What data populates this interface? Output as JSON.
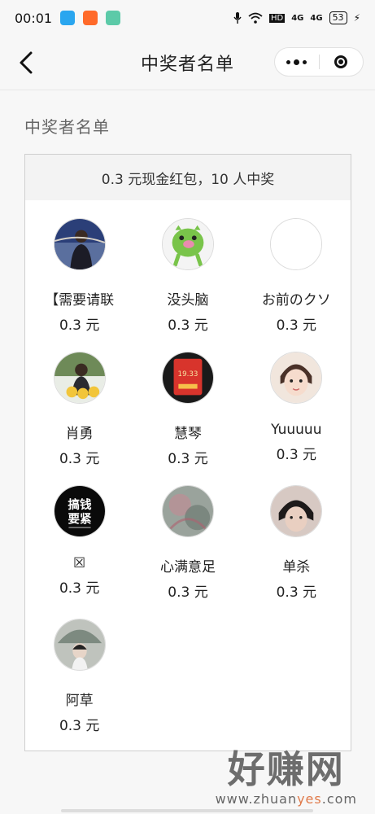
{
  "status_bar": {
    "time": "00:01",
    "signal_1": "4G",
    "signal_2": "4G",
    "hd": "HD",
    "battery": "53"
  },
  "nav": {
    "title": "中奖者名单"
  },
  "section": {
    "title": "中奖者名单"
  },
  "prize": {
    "summary": "0.3 元现金红包，10 人中奖"
  },
  "winners": [
    {
      "name": "【需要请联",
      "amount": "0.3 元",
      "avatar": "photo-man-outdoor"
    },
    {
      "name": "没头脑",
      "amount": "0.3 元",
      "avatar": "green-pig-cartoon"
    },
    {
      "name": "お前のクソ",
      "amount": "0.3 元",
      "avatar": "blank"
    },
    {
      "name": "肖勇",
      "amount": "0.3 元",
      "avatar": "photo-man-emoji"
    },
    {
      "name": "慧琴",
      "amount": "0.3 元",
      "avatar": "red-packet-photo"
    },
    {
      "name": "Yuuuuu",
      "amount": "0.3 元",
      "avatar": "photo-girl"
    },
    {
      "name": "☒",
      "amount": "0.3 元",
      "avatar": "black-text-logo"
    },
    {
      "name": "心满意足",
      "amount": "0.3 元",
      "avatar": "gray-pink-abstract"
    },
    {
      "name": "单杀",
      "amount": "0.3 元",
      "avatar": "photo-boy"
    },
    {
      "name": "阿草",
      "amount": "0.3 元",
      "avatar": "photo-woman-umbrella"
    }
  ],
  "avatar_text": {
    "line1": "搞钱",
    "line2": "要紧",
    "packet_value": "19.33"
  },
  "watermark": {
    "brand": "好赚网",
    "url_prefix": "www.zhuan",
    "url_highlight": "yes",
    "url_suffix": ".com"
  },
  "colors": {
    "background": "#f7f7f7",
    "card_header": "#f3f3f3",
    "text": "#222222",
    "muted": "#666666"
  }
}
